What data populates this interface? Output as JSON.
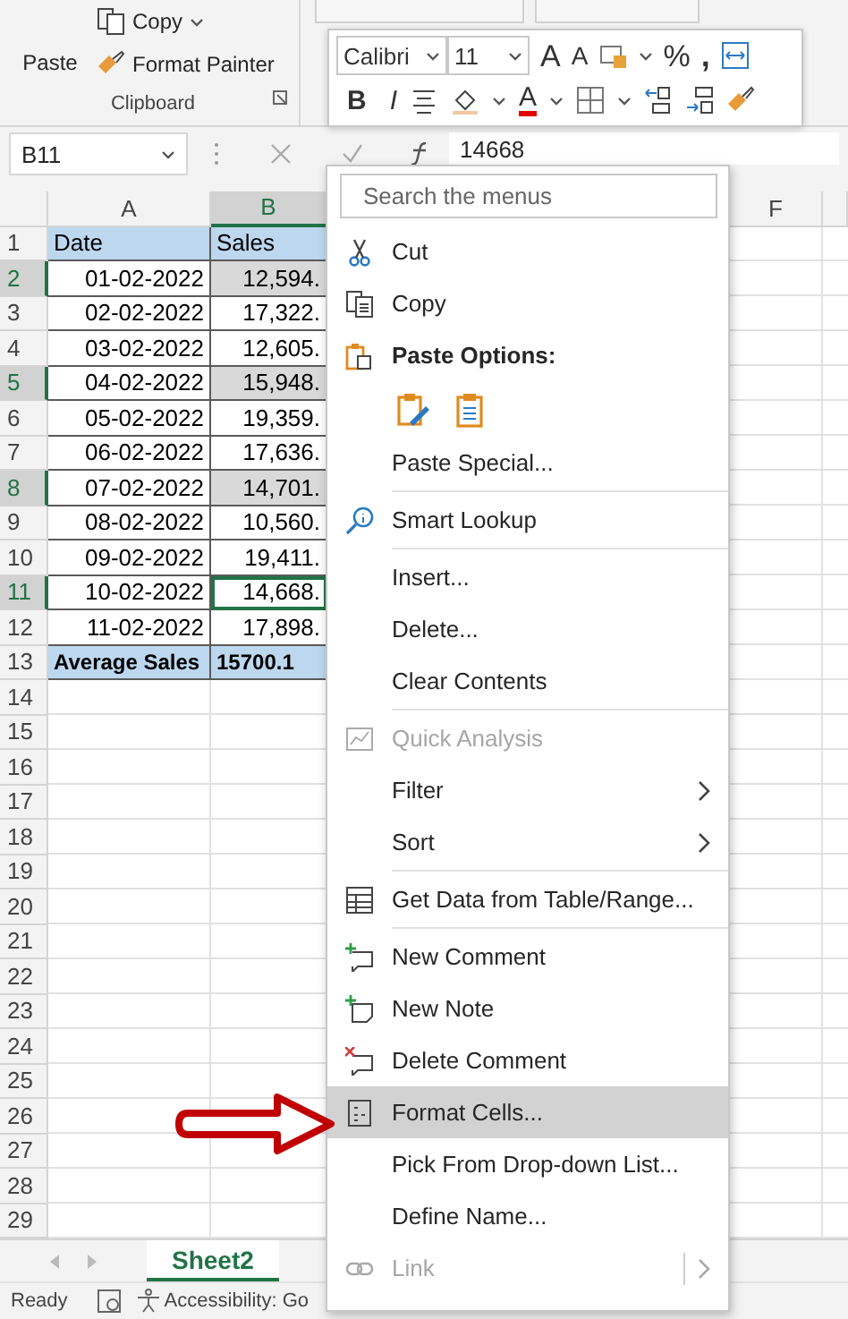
{
  "ribbon": {
    "paste": "Paste",
    "copy": "Copy",
    "format_painter": "Format Painter",
    "group": "Clipboard"
  },
  "mini_toolbar": {
    "font": "Calibri",
    "size": "11",
    "grow": "A",
    "shrink": "A",
    "percent": "%",
    "comma": ",",
    "bold": "B",
    "italic": "I",
    "font_color": "A"
  },
  "formula_bar": {
    "name_box": "B11",
    "formula": "14668"
  },
  "columns": [
    {
      "label": "A",
      "selected": false
    },
    {
      "label": "B",
      "selected": true
    },
    {
      "label": "F",
      "selected": false
    }
  ],
  "rows": [
    {
      "number": "1",
      "kind": "header",
      "date": "Date",
      "sales": "Sales",
      "selected": false,
      "active": false
    },
    {
      "number": "2",
      "kind": "data",
      "date": "01-02-2022",
      "sales": "12,594.",
      "selected": true,
      "active": false
    },
    {
      "number": "3",
      "kind": "data",
      "date": "02-02-2022",
      "sales": "17,322.",
      "selected": false,
      "active": false
    },
    {
      "number": "4",
      "kind": "data",
      "date": "03-02-2022",
      "sales": "12,605.",
      "selected": false,
      "active": false
    },
    {
      "number": "5",
      "kind": "data",
      "date": "04-02-2022",
      "sales": "15,948.",
      "selected": true,
      "active": false
    },
    {
      "number": "6",
      "kind": "data",
      "date": "05-02-2022",
      "sales": "19,359.",
      "selected": false,
      "active": false
    },
    {
      "number": "7",
      "kind": "data",
      "date": "06-02-2022",
      "sales": "17,636.",
      "selected": false,
      "active": false
    },
    {
      "number": "8",
      "kind": "data",
      "date": "07-02-2022",
      "sales": "14,701.",
      "selected": true,
      "active": false
    },
    {
      "number": "9",
      "kind": "data",
      "date": "08-02-2022",
      "sales": "10,560.",
      "selected": false,
      "active": false
    },
    {
      "number": "10",
      "kind": "data",
      "date": "09-02-2022",
      "sales": "19,411.",
      "selected": false,
      "active": false
    },
    {
      "number": "11",
      "kind": "data",
      "date": "10-02-2022",
      "sales": "14,668.",
      "selected": true,
      "active": true
    },
    {
      "number": "12",
      "kind": "data",
      "date": "11-02-2022",
      "sales": "17,898.",
      "selected": false,
      "active": false
    },
    {
      "number": "13",
      "kind": "total",
      "date": "Average Sales",
      "sales": "15700.1",
      "selected": false,
      "active": false
    },
    {
      "number": "14",
      "kind": "empty"
    },
    {
      "number": "15",
      "kind": "empty"
    },
    {
      "number": "16",
      "kind": "empty"
    },
    {
      "number": "17",
      "kind": "empty"
    },
    {
      "number": "18",
      "kind": "empty"
    },
    {
      "number": "19",
      "kind": "empty"
    },
    {
      "number": "20",
      "kind": "empty"
    },
    {
      "number": "21",
      "kind": "empty"
    },
    {
      "number": "22",
      "kind": "empty"
    },
    {
      "number": "23",
      "kind": "empty"
    },
    {
      "number": "24",
      "kind": "empty"
    },
    {
      "number": "25",
      "kind": "empty"
    },
    {
      "number": "26",
      "kind": "empty"
    },
    {
      "number": "27",
      "kind": "empty"
    },
    {
      "number": "28",
      "kind": "empty"
    },
    {
      "number": "29",
      "kind": "empty"
    }
  ],
  "sheet_tabs": [
    {
      "label": "Sheet2",
      "selected": true
    }
  ],
  "status_bar": {
    "status": "Ready",
    "accessibility": "Accessibility: Go"
  },
  "context_menu": {
    "search": {
      "placeholder": "Search the menus"
    },
    "items": [
      {
        "kind": "item",
        "label": "Cut",
        "selected": false,
        "disabled": false,
        "submenu": false
      },
      {
        "kind": "item",
        "label": "Copy",
        "selected": false,
        "disabled": false,
        "submenu": false
      },
      {
        "kind": "header",
        "label": "Paste Options:"
      },
      {
        "kind": "paste-icons"
      },
      {
        "kind": "item",
        "label": "Paste Special...",
        "selected": false,
        "disabled": false,
        "submenu": false
      },
      {
        "kind": "separator"
      },
      {
        "kind": "item",
        "label": "Smart Lookup",
        "selected": false,
        "disabled": false,
        "submenu": false
      },
      {
        "kind": "separator"
      },
      {
        "kind": "item",
        "label": "Insert...",
        "selected": false,
        "disabled": false,
        "submenu": false
      },
      {
        "kind": "item",
        "label": "Delete...",
        "selected": false,
        "disabled": false,
        "submenu": false
      },
      {
        "kind": "item",
        "label": "Clear Contents",
        "selected": false,
        "disabled": false,
        "submenu": false
      },
      {
        "kind": "separator"
      },
      {
        "kind": "item",
        "label": "Quick Analysis",
        "selected": false,
        "disabled": true,
        "submenu": false
      },
      {
        "kind": "item",
        "label": "Filter",
        "selected": false,
        "disabled": false,
        "submenu": true
      },
      {
        "kind": "item",
        "label": "Sort",
        "selected": false,
        "disabled": false,
        "submenu": true
      },
      {
        "kind": "separator"
      },
      {
        "kind": "item",
        "label": "Get Data from Table/Range...",
        "selected": false,
        "disabled": false,
        "submenu": false
      },
      {
        "kind": "separator"
      },
      {
        "kind": "item",
        "label": "New Comment",
        "selected": false,
        "disabled": false,
        "submenu": false
      },
      {
        "kind": "item",
        "label": "New Note",
        "selected": false,
        "disabled": false,
        "submenu": false
      },
      {
        "kind": "item",
        "label": "Delete Comment",
        "selected": false,
        "disabled": false,
        "submenu": false
      },
      {
        "kind": "item",
        "label": "Format Cells...",
        "selected": true,
        "disabled": false,
        "submenu": false
      },
      {
        "kind": "item",
        "label": "Pick From Drop-down List...",
        "selected": false,
        "disabled": false,
        "submenu": false
      },
      {
        "kind": "item",
        "label": "Define Name...",
        "selected": false,
        "disabled": false,
        "submenu": false
      },
      {
        "kind": "item",
        "label": "Link",
        "selected": false,
        "disabled": true,
        "submenu": true
      }
    ]
  }
}
